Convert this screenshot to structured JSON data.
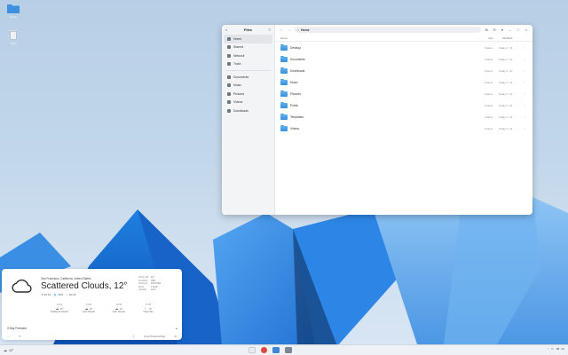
{
  "desktop": {
    "icons": [
      {
        "name": "Home",
        "icon": "folder-icon"
      },
      {
        "name": "Trash",
        "icon": "trash-icon"
      }
    ]
  },
  "files": {
    "title": "Files",
    "path": "Home",
    "sidebar": [
      {
        "label": "Home",
        "icon": "home-icon",
        "active": true
      },
      {
        "label": "Starred",
        "icon": "star-icon"
      },
      {
        "label": "Network",
        "icon": "network-icon"
      },
      {
        "label": "Trash",
        "icon": "trash-icon"
      },
      {
        "label": "Documents",
        "icon": "documents-icon"
      },
      {
        "label": "Music",
        "icon": "music-icon"
      },
      {
        "label": "Pictures",
        "icon": "pictures-icon"
      },
      {
        "label": "Videos",
        "icon": "videos-icon"
      },
      {
        "label": "Downloads",
        "icon": "downloads-icon"
      }
    ],
    "columns": {
      "name": "Name",
      "size": "Size",
      "modified": "Modified"
    },
    "rows": [
      {
        "name": "Desktop",
        "size": "0 items",
        "modified": "Today 4 : 14"
      },
      {
        "name": "Documents",
        "size": "0 items",
        "modified": "Today 4 : 14"
      },
      {
        "name": "Downloads",
        "size": "0 items",
        "modified": "Today 4 : 14"
      },
      {
        "name": "Music",
        "size": "0 items",
        "modified": "Today 4 : 14"
      },
      {
        "name": "Pictures",
        "size": "0 items",
        "modified": "Today 4 : 14"
      },
      {
        "name": "Public",
        "size": "0 items",
        "modified": "Today 4 : 14"
      },
      {
        "name": "Templates",
        "size": "3 items",
        "modified": "Today 4 : 14"
      },
      {
        "name": "Videos",
        "size": "0 items",
        "modified": "Today 4 : 14"
      }
    ]
  },
  "weather": {
    "location": "San Francisco, California, United States",
    "condition": "Scattered Clouds, 12°",
    "sunrise": "06:13",
    "humidity": "79%",
    "sunset": "20:23",
    "details": [
      {
        "k": "Wind chill",
        "v": "12°"
      },
      {
        "k": "Humidity",
        "v": "79%"
      },
      {
        "k": "Pressure",
        "v": "1013 hPa"
      },
      {
        "k": "Wind",
        "v": "7 km/h"
      },
      {
        "k": "Visibility",
        "v": "4 km"
      }
    ],
    "forecast": [
      {
        "time": "11:00",
        "temp": "15°",
        "desc": "Scattered Clouds"
      },
      {
        "time": "13:00",
        "temp": "16°",
        "desc": "Few Clouds"
      },
      {
        "time": "15:00",
        "temp": "16°",
        "desc": "Few Clouds"
      },
      {
        "time": "17:00",
        "temp": "15°",
        "desc": "Clear Sky"
      }
    ],
    "three_day": "3 Day Forecast",
    "source": "OpenWeatherMap"
  },
  "taskbar": {
    "weather_temp": "12°",
    "clock": "08 : 12"
  }
}
